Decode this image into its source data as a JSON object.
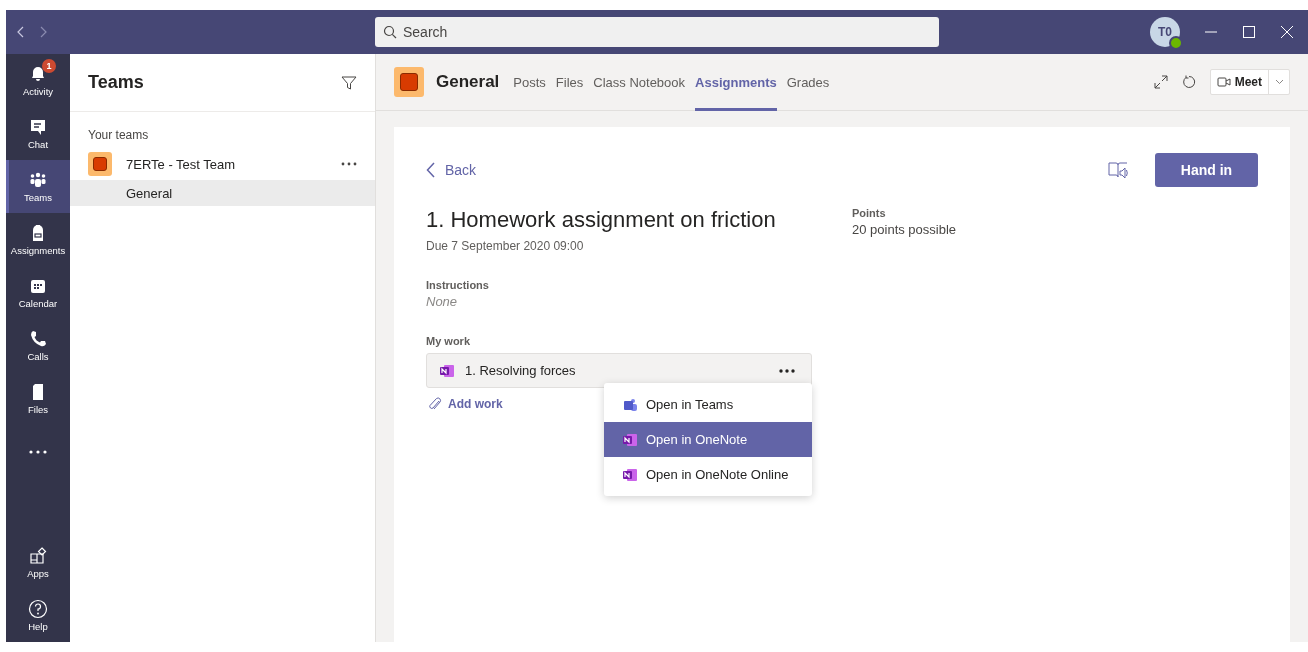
{
  "titlebar": {
    "search": {
      "placeholder": "Search"
    },
    "avatar": {
      "initials": "T0"
    }
  },
  "rail": [
    {
      "label": "Activity",
      "kind": "bell",
      "badge": "1",
      "selected": false
    },
    {
      "label": "Chat",
      "kind": "chat",
      "selected": false
    },
    {
      "label": "Teams",
      "kind": "teams",
      "selected": true
    },
    {
      "label": "Assignments",
      "kind": "bag",
      "selected": false
    },
    {
      "label": "Calendar",
      "kind": "calendar",
      "selected": false
    },
    {
      "label": "Calls",
      "kind": "phone",
      "selected": false
    },
    {
      "label": "Files",
      "kind": "file",
      "selected": false
    }
  ],
  "rail_bottom": [
    {
      "label": "Apps",
      "kind": "apps",
      "selected": false
    },
    {
      "label": "Help",
      "kind": "help",
      "selected": false
    }
  ],
  "teams_panel": {
    "title": "Teams",
    "section": "Your teams",
    "teams": [
      {
        "name": "7ERTe - Test Team",
        "channels": [
          {
            "name": "General",
            "selected": true
          }
        ]
      }
    ]
  },
  "channel_header": {
    "title": "General",
    "tabs": [
      {
        "label": "Posts",
        "selected": false
      },
      {
        "label": "Files",
        "selected": false
      },
      {
        "label": "Class Notebook",
        "selected": false
      },
      {
        "label": "Assignments",
        "selected": true
      },
      {
        "label": "Grades",
        "selected": false
      }
    ],
    "meet": "Meet"
  },
  "assignment": {
    "back": "Back",
    "hand_in": "Hand in",
    "title": "1. Homework assignment on friction",
    "due": "Due 7 September 2020 09:00",
    "instructions_label": "Instructions",
    "instructions": "None",
    "points_label": "Points",
    "points": "20 points possible",
    "my_work_label": "My work",
    "work": [
      {
        "name": "1. Resolving forces"
      }
    ],
    "add_work": "Add work",
    "menu": [
      {
        "label": "Open in Teams",
        "kind": "teams",
        "selected": false
      },
      {
        "label": "Open in OneNote",
        "kind": "onenote",
        "selected": true
      },
      {
        "label": "Open in OneNote Online",
        "kind": "onenote",
        "selected": false
      }
    ]
  }
}
